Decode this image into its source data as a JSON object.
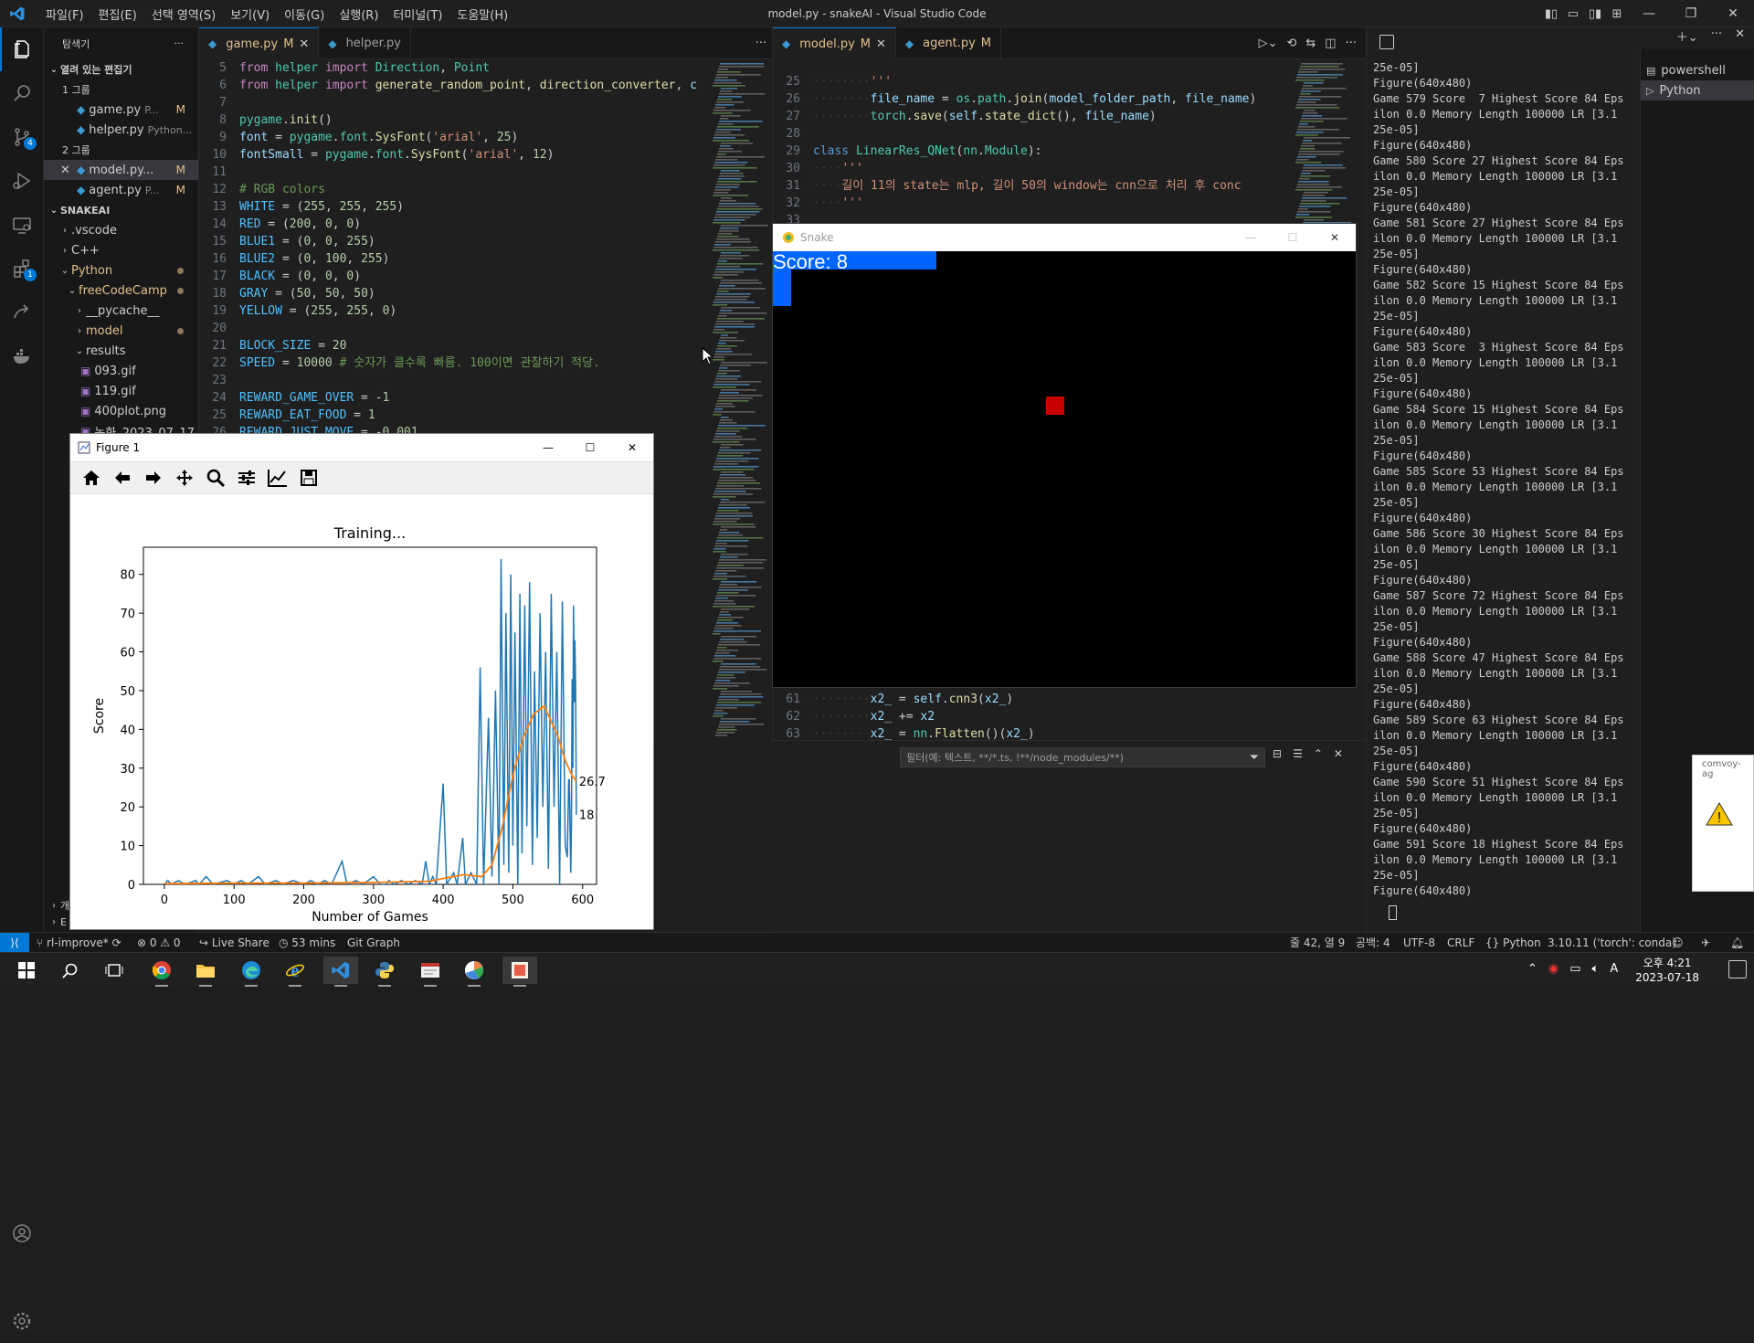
{
  "window": {
    "title": "model.py - snakeAI - Visual Studio Code",
    "menu": [
      "파일(F)",
      "편집(E)",
      "선택 영역(S)",
      "보기(V)",
      "이동(G)",
      "실행(R)",
      "터미널(T)",
      "도움말(H)"
    ]
  },
  "activity_bar": {
    "icons": [
      "explorer-icon",
      "search-icon",
      "source-control-icon",
      "run-debug-icon",
      "remote-explorer-icon",
      "extensions-icon",
      "live-share-icon",
      "docker-icon",
      "account-icon",
      "settings-gear-icon"
    ],
    "source_control_badge": "4",
    "extensions_badge": "1"
  },
  "explorer": {
    "title": "탐색기",
    "open_editors_label": "열려 있는 편집기",
    "group1_label": "1 그룹",
    "group2_label": "2 그룹",
    "open_editors_g1": [
      {
        "name": "game.py",
        "path": "P...",
        "status": "M"
      },
      {
        "name": "helper.py",
        "path": "Python...",
        "status": ""
      }
    ],
    "open_editors_g2": [
      {
        "name": "model.py...",
        "path": "",
        "status": "M"
      },
      {
        "name": "agent.py",
        "path": "P...",
        "status": "M"
      }
    ],
    "project_label": "SNAKEAI",
    "tree": [
      {
        "label": ".vscode",
        "level": 1,
        "kind": "folder-closed"
      },
      {
        "label": "C++",
        "level": 1,
        "kind": "folder-closed"
      },
      {
        "label": "Python",
        "level": 1,
        "kind": "folder-open",
        "dirty": true
      },
      {
        "label": "freeCodeCamp",
        "level": 2,
        "kind": "folder-open",
        "dirty": true
      },
      {
        "label": "__pycache__",
        "level": 3,
        "kind": "folder-closed"
      },
      {
        "label": "model",
        "level": 3,
        "kind": "folder-closed",
        "dirty": true
      },
      {
        "label": "results",
        "level": 3,
        "kind": "folder-open"
      },
      {
        "label": "093.gif",
        "level": 4,
        "kind": "image"
      },
      {
        "label": "119.gif",
        "level": 4,
        "kind": "image"
      },
      {
        "label": "400plot.png",
        "level": 4,
        "kind": "image"
      },
      {
        "label": "녹화_2023_07_17...",
        "level": 4,
        "kind": "image"
      }
    ]
  },
  "editor_left": {
    "tabs": [
      {
        "label": "game.py",
        "status": "M",
        "active": true
      },
      {
        "label": "helper.py",
        "status": "",
        "active": false
      }
    ],
    "lines": [
      {
        "n": "5",
        "html": "<span class='kw'>from</span> <span class='cl'>helper</span> <span class='kw'>import</span> <span class='cl'>Direction</span>, <span class='cl'>Point</span>"
      },
      {
        "n": "6",
        "html": "<span class='kw'>from</span> <span class='cl'>helper</span> <span class='kw'>import</span> <span class='fn'>generate_random_point</span>, <span class='fn'>direction_converter</span>, <span class='va'>c</span>"
      },
      {
        "n": "7",
        "html": ""
      },
      {
        "n": "8",
        "html": "<span class='cl'>pygame</span>.<span class='fn'>init</span>()"
      },
      {
        "n": "9",
        "html": "<span class='va'>font</span> = <span class='cl'>pygame</span>.<span class='cl'>font</span>.<span class='fn'>SysFont</span>(<span class='st'>'arial'</span>, <span class='nm'>25</span>)"
      },
      {
        "n": "10",
        "html": "<span class='va'>fontSmall</span> = <span class='cl'>pygame</span>.<span class='cl'>font</span>.<span class='fn'>SysFont</span>(<span class='st'>'arial'</span>, <span class='nm'>12</span>)"
      },
      {
        "n": "11",
        "html": ""
      },
      {
        "n": "12",
        "html": "<span class='cm'># RGB colors</span>"
      },
      {
        "n": "13",
        "html": "<span class='cs'>WHITE</span> = (<span class='nm'>255</span>, <span class='nm'>255</span>, <span class='nm'>255</span>)"
      },
      {
        "n": "14",
        "html": "<span class='cs'>RED</span> = (<span class='nm'>200</span>, <span class='nm'>0</span>, <span class='nm'>0</span>)"
      },
      {
        "n": "15",
        "html": "<span class='cs'>BLUE1</span> = (<span class='nm'>0</span>, <span class='nm'>0</span>, <span class='nm'>255</span>)"
      },
      {
        "n": "16",
        "html": "<span class='cs'>BLUE2</span> = (<span class='nm'>0</span>, <span class='nm'>100</span>, <span class='nm'>255</span>)"
      },
      {
        "n": "17",
        "html": "<span class='cs'>BLACK</span> = (<span class='nm'>0</span>, <span class='nm'>0</span>, <span class='nm'>0</span>)"
      },
      {
        "n": "18",
        "html": "<span class='cs'>GRAY</span> = (<span class='nm'>50</span>, <span class='nm'>50</span>, <span class='nm'>50</span>)"
      },
      {
        "n": "19",
        "html": "<span class='cs'>YELLOW</span> = (<span class='nm'>255</span>, <span class='nm'>255</span>, <span class='nm'>0</span>)"
      },
      {
        "n": "20",
        "html": ""
      },
      {
        "n": "21",
        "html": "<span class='cs'>BLOCK_SIZE</span> = <span class='nm'>20</span>"
      },
      {
        "n": "22",
        "html": "<span class='cs'>SPEED</span> = <span class='nm'>10000</span> <span class='cm'># 숫자가 클수록 빠름. 100이면 관찰하기 적당.</span>"
      },
      {
        "n": "23",
        "html": ""
      },
      {
        "n": "24",
        "html": "<span class='cs'>REWARD_GAME_OVER</span> = -<span class='nm'>1</span>"
      },
      {
        "n": "25",
        "html": "<span class='cs'>REWARD_EAT_FOOD</span> = <span class='nm'>1</span>"
      },
      {
        "n": "26",
        "html": "<span class='cs'>REWARD_JUST_MOVE</span> = -<span class='nm'>0.001</span>"
      }
    ]
  },
  "editor_right": {
    "tabs": [
      {
        "label": "model.py",
        "status": "M",
        "active": true
      },
      {
        "label": "agent.py",
        "status": "M",
        "active": false
      }
    ],
    "lines_top": [
      {
        "n": "25",
        "html": "<span class='ws'>········</span><span class='st'>'''</span>"
      },
      {
        "n": "26",
        "html": "<span class='ws'>········</span><span class='va'>file_name</span> = <span class='cl'>os</span>.<span class='cl'>path</span>.<span class='fn'>join</span>(<span class='va'>model_folder_path</span>, <span class='va'>file_name</span>)"
      },
      {
        "n": "27",
        "html": "<span class='ws'>········</span><span class='cl'>torch</span>.<span class='fn'>save</span>(<span class='va'>self</span>.<span class='fn'>state_dict</span>(), <span class='va'>file_name</span>)"
      },
      {
        "n": "28",
        "html": ""
      },
      {
        "n": "29",
        "html": "<span class='kb'>class</span> <span class='cl'>LinearRes_QNet</span>(<span class='cl'>nn</span>.<span class='cl'>Module</span>):"
      },
      {
        "n": "30",
        "html": "<span class='ws'>····</span><span class='st'>'''</span>"
      },
      {
        "n": "31",
        "html": "<span class='ws'>····</span><span class='st'>길이 11의 state는 mlp, 길이 50의 window는 cnn으로 처리 후 conc</span>"
      },
      {
        "n": "32",
        "html": "<span class='ws'>····</span><span class='st'>'''</span>"
      },
      {
        "n": "33",
        "html": ""
      }
    ],
    "lines_bottom": [
      {
        "n": "61",
        "html": "<span class='ws'>········</span><span class='va'>x2_</span> = <span class='va'>self</span>.<span class='fn'>cnn3</span>(<span class='va'>x2_</span>)"
      },
      {
        "n": "62",
        "html": "<span class='ws'>········</span><span class='va'>x2_</span> += <span class='va'>x2</span>"
      },
      {
        "n": "63",
        "html": "<span class='ws'>········</span><span class='va'>x2_</span> = <span class='cl'>nn</span>.<span class='fn'>Flatten</span>()(<span class='va'>x2_</span>)"
      }
    ]
  },
  "panel": {
    "filter_placeholder": "필터(예: 텍스트, **/*.ts, !**/node_modules/**)"
  },
  "terminal": {
    "tabs": [
      "powershell",
      "Python"
    ],
    "text": "25e-05]\nFigure(640x480)\nGame 579 Score  7 Highest Score 84 Eps\nilon 0.0 Memory Length 100000 LR [3.1\n25e-05]\nFigure(640x480)\nGame 580 Score 27 Highest Score 84 Eps\nilon 0.0 Memory Length 100000 LR [3.1\n25e-05]\nFigure(640x480)\nGame 581 Score 27 Highest Score 84 Eps\nilon 0.0 Memory Length 100000 LR [3.1\n25e-05]\nFigure(640x480)\nGame 582 Score 15 Highest Score 84 Eps\nilon 0.0 Memory Length 100000 LR [3.1\n25e-05]\nFigure(640x480)\nGame 583 Score  3 Highest Score 84 Eps\nilon 0.0 Memory Length 100000 LR [3.1\n25e-05]\nFigure(640x480)\nGame 584 Score 15 Highest Score 84 Eps\nilon 0.0 Memory Length 100000 LR [3.1\n25e-05]\nFigure(640x480)\nGame 585 Score 53 Highest Score 84 Eps\nilon 0.0 Memory Length 100000 LR [3.1\n25e-05]\nFigure(640x480)\nGame 586 Score 30 Highest Score 84 Eps\nilon 0.0 Memory Length 100000 LR [3.1\n25e-05]\nFigure(640x480)\nGame 587 Score 72 Highest Score 84 Eps\nilon 0.0 Memory Length 100000 LR [3.1\n25e-05]\nFigure(640x480)\nGame 588 Score 47 Highest Score 84 Eps\nilon 0.0 Memory Length 100000 LR [3.1\n25e-05]\nFigure(640x480)\nGame 589 Score 63 Highest Score 84 Eps\nilon 0.0 Memory Length 100000 LR [3.1\n25e-05]\nFigure(640x480)\nGame 590 Score 51 Highest Score 84 Eps\nilon 0.0 Memory Length 100000 LR [3.1\n25e-05]\nFigure(640x480)\nGame 591 Score 18 Highest Score 84 Eps\nilon 0.0 Memory Length 100000 LR [3.1\n25e-05]\nFigure(640x480)"
  },
  "snake_window": {
    "title": "Snake",
    "score_text": "Score: 8",
    "colors": {
      "snake": "#0064ff",
      "food": "#c80000",
      "bg": "#000000"
    }
  },
  "figure_window": {
    "title": "Figure 1",
    "toolbar": [
      "home-icon",
      "back-arrow-icon",
      "forward-arrow-icon",
      "pan-icon",
      "zoom-icon",
      "subplots-config-icon",
      "edit-axis-icon",
      "save-icon"
    ]
  },
  "chart_data": {
    "type": "line",
    "title": "Training...",
    "xlabel": "Number of Games",
    "ylabel": "Score",
    "xlim": [
      -30,
      620
    ],
    "ylim": [
      0,
      87
    ],
    "xticks": [
      0,
      100,
      200,
      300,
      400,
      500,
      600
    ],
    "yticks": [
      0,
      10,
      20,
      30,
      40,
      50,
      60,
      70,
      80
    ],
    "series": [
      {
        "color": "#1f77b4",
        "values_sparse": [
          [
            0,
            0
          ],
          [
            5,
            1
          ],
          [
            10,
            0
          ],
          [
            20,
            1
          ],
          [
            30,
            0
          ],
          [
            45,
            1
          ],
          [
            50,
            0
          ],
          [
            60,
            2
          ],
          [
            70,
            0
          ],
          [
            90,
            1
          ],
          [
            100,
            0
          ],
          [
            110,
            1
          ],
          [
            120,
            0
          ],
          [
            135,
            2
          ],
          [
            145,
            0
          ],
          [
            160,
            1
          ],
          [
            170,
            0
          ],
          [
            185,
            1
          ],
          [
            200,
            0
          ],
          [
            210,
            1
          ],
          [
            220,
            0
          ],
          [
            230,
            1
          ],
          [
            240,
            0
          ],
          [
            255,
            6
          ],
          [
            262,
            0
          ],
          [
            275,
            1
          ],
          [
            285,
            0
          ],
          [
            300,
            2
          ],
          [
            310,
            0
          ],
          [
            318,
            0
          ],
          [
            322,
            1
          ],
          [
            330,
            0
          ],
          [
            340,
            1
          ],
          [
            350,
            0
          ],
          [
            360,
            1
          ],
          [
            370,
            0
          ],
          [
            375,
            6
          ],
          [
            380,
            0
          ],
          [
            385,
            2
          ],
          [
            390,
            0
          ],
          [
            400,
            26
          ],
          [
            405,
            0
          ],
          [
            415,
            3
          ],
          [
            420,
            0
          ],
          [
            428,
            12
          ],
          [
            432,
            0
          ],
          [
            440,
            3
          ],
          [
            448,
            0
          ],
          [
            453,
            56
          ],
          [
            458,
            0
          ],
          [
            465,
            43
          ],
          [
            470,
            2
          ],
          [
            475,
            50
          ],
          [
            480,
            0
          ],
          [
            483,
            84
          ],
          [
            487,
            5
          ],
          [
            490,
            70
          ],
          [
            494,
            3
          ],
          [
            497,
            80
          ],
          [
            500,
            10
          ],
          [
            503,
            65
          ],
          [
            507,
            0
          ],
          [
            510,
            75
          ],
          [
            513,
            8
          ],
          [
            517,
            72
          ],
          [
            520,
            15
          ],
          [
            524,
            78
          ],
          [
            528,
            5
          ],
          [
            531,
            55
          ],
          [
            535,
            12
          ],
          [
            539,
            70
          ],
          [
            543,
            20
          ],
          [
            547,
            60
          ],
          [
            551,
            4
          ],
          [
            555,
            75
          ],
          [
            559,
            20
          ],
          [
            563,
            60
          ],
          [
            567,
            0
          ],
          [
            571,
            73
          ],
          [
            575,
            10
          ],
          [
            578,
            7
          ],
          [
            580,
            27
          ],
          [
            581,
            27
          ],
          [
            582,
            15
          ],
          [
            583,
            3
          ],
          [
            584,
            15
          ],
          [
            585,
            53
          ],
          [
            586,
            30
          ],
          [
            587,
            72
          ],
          [
            588,
            47
          ],
          [
            589,
            63
          ],
          [
            590,
            51
          ],
          [
            591,
            18
          ]
        ]
      },
      {
        "color": "#ff7f0e",
        "values_sparse": [
          [
            0,
            0.2
          ],
          [
            100,
            0.3
          ],
          [
            200,
            0.3
          ],
          [
            300,
            0.5
          ],
          [
            380,
            0.8
          ],
          [
            400,
            1.5
          ],
          [
            430,
            2.5
          ],
          [
            455,
            2
          ],
          [
            470,
            5
          ],
          [
            485,
            15
          ],
          [
            500,
            28
          ],
          [
            515,
            38
          ],
          [
            530,
            44
          ],
          [
            545,
            46
          ],
          [
            555,
            42
          ],
          [
            565,
            38
          ],
          [
            575,
            32
          ],
          [
            585,
            28
          ],
          [
            591,
            26.7
          ]
        ]
      }
    ],
    "annotations": [
      "26.7",
      "18"
    ]
  },
  "statusbar": {
    "remote_icon": "remote-icon",
    "branch": "rl-improve*",
    "problems": "0",
    "warnings": "0",
    "liveshare": "Live Share",
    "time_tracked": "53 mins",
    "gitgraph": "Git Graph",
    "cursor": "줄 42, 열 9",
    "spaces": "공백: 4",
    "encoding": "UTF-8",
    "eol": "CRLF",
    "language": "Python",
    "interpreter": "3.10.11 ('torch': conda)"
  },
  "notification": {
    "text": "comvoy-ag"
  },
  "taskbar": {
    "time": "오후 4:21",
    "date": "2023-07-18",
    "ime": "A",
    "apps": [
      "windows-start-icon",
      "search-icon",
      "task-view-icon",
      "chrome-icon",
      "file-explorer-icon",
      "edge-icon",
      "ie-icon",
      "vscode-icon",
      "python-icon",
      "notepad-icon",
      "paint-icon",
      "pygame-icon"
    ]
  }
}
